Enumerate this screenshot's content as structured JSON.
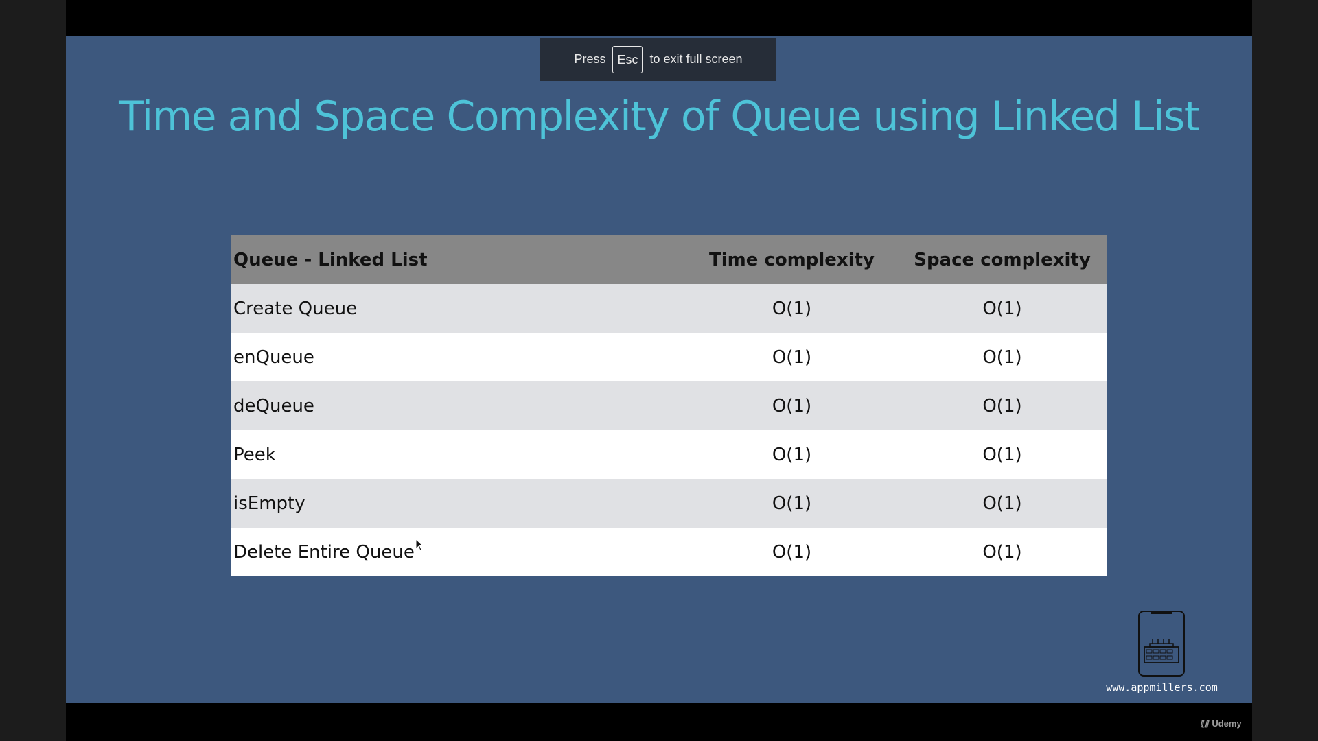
{
  "fullscreen_toast": {
    "press": "Press",
    "key": "Esc",
    "suffix": "to exit full screen"
  },
  "slide": {
    "title": "Time and Space Complexity of Queue using Linked List"
  },
  "table": {
    "headers": [
      "Queue - Linked List",
      "Time complexity",
      "Space complexity"
    ],
    "rows": [
      [
        "Create Queue",
        "O(1)",
        "O(1)"
      ],
      [
        "enQueue",
        "O(1)",
        "O(1)"
      ],
      [
        "deQueue",
        "O(1)",
        "O(1)"
      ],
      [
        "Peek",
        "O(1)",
        "O(1)"
      ],
      [
        "isEmpty",
        "O(1)",
        "O(1)"
      ],
      [
        "Delete Entire Queue",
        "O(1)",
        "O(1)"
      ]
    ]
  },
  "branding": {
    "url": "www.appmillers.com",
    "platform": "Udemy"
  },
  "colors": {
    "slide_bg": "#3d587e",
    "title": "#4ec3d8",
    "header_bg": "#878787",
    "row_alt": "#e0e1e4"
  }
}
